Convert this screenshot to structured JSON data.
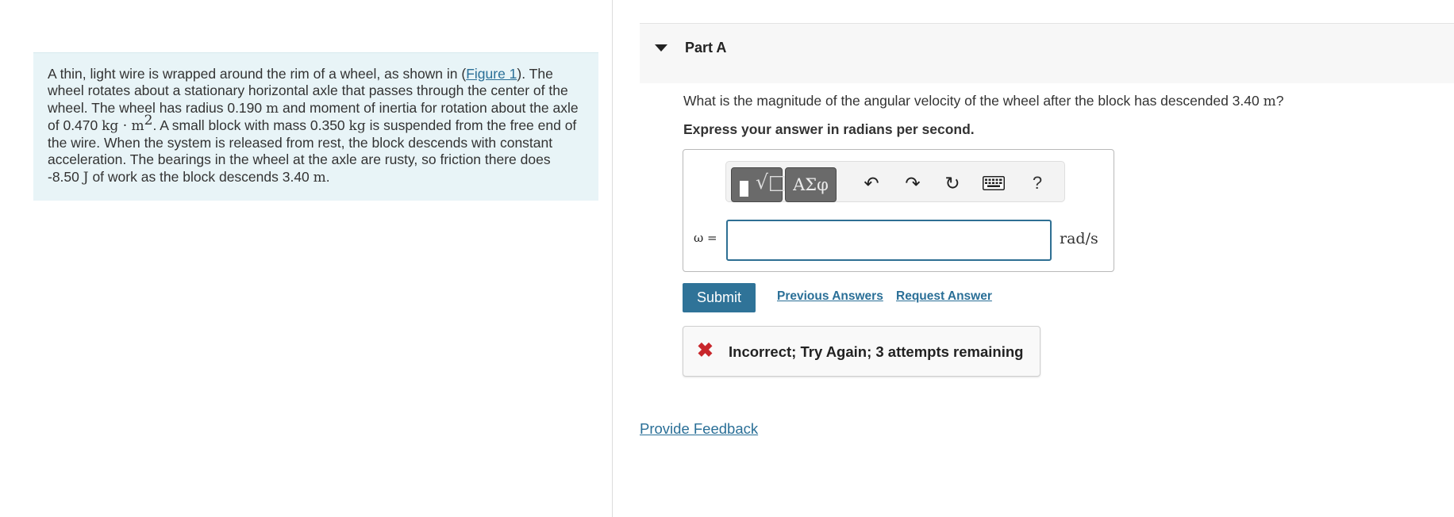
{
  "problem": {
    "lines": [
      {
        "pre": "A thin, light wire is wrapped around the rim of a wheel, as shown in (",
        "link": "Figure 1",
        "post": "). The"
      },
      {
        "text": "wheel rotates about a stationary horizontal axle that passes through the center of the"
      },
      {
        "pre": "wheel. The wheel has radius 0.190 ",
        "unit": "m",
        "post": " and moment of inertia for rotation about the axle"
      },
      {
        "pre": "of 0.470 ",
        "unit": "kg · m",
        "sup": "2",
        "mid": ". A small block with mass 0.350 ",
        "unit2": "kg",
        "post": " is suspended from the free end of"
      },
      {
        "text": "the wire. When the system is released from rest, the block descends with constant"
      },
      {
        "text": "acceleration. The bearings in the wheel at the axle are rusty, so friction there does"
      },
      {
        "pre": "-8.50 ",
        "unit": "J",
        "mid": " of work as the block descends 3.40 ",
        "unit2": "m",
        "post": "."
      }
    ]
  },
  "part": {
    "title": "Part A",
    "question_pre": "What is the magnitude of the angular velocity of the wheel after the block has descended 3.40 ",
    "question_unit": "m",
    "question_post": "?",
    "instruction": "Express your answer in radians per second."
  },
  "toolbar": {
    "template_icon": "template-radical-icon",
    "template_glyph": "√□",
    "greek_label": "ΑΣφ",
    "undo_icon": "undo-icon",
    "undo_glyph": "↶",
    "redo_icon": "redo-icon",
    "redo_glyph": "↷",
    "reset_icon": "reset-icon",
    "reset_glyph": "↻",
    "keyboard_icon": "keyboard-icon",
    "help_glyph": "?"
  },
  "answer": {
    "variable_label": "ω =",
    "value": "",
    "unit": "rad/s"
  },
  "actions": {
    "submit": "Submit",
    "previous_answers": "Previous Answers",
    "request_answer": "Request Answer"
  },
  "feedback": {
    "icon": "x-mark-icon",
    "glyph": "✖",
    "text": "Incorrect; Try Again; 3 attempts remaining"
  },
  "footer": {
    "provide_feedback": "Provide Feedback"
  },
  "colors": {
    "accent": "#2f7398",
    "link": "#2a6f97",
    "error": "#c8262b",
    "problem_bg": "#e8f4f7"
  }
}
